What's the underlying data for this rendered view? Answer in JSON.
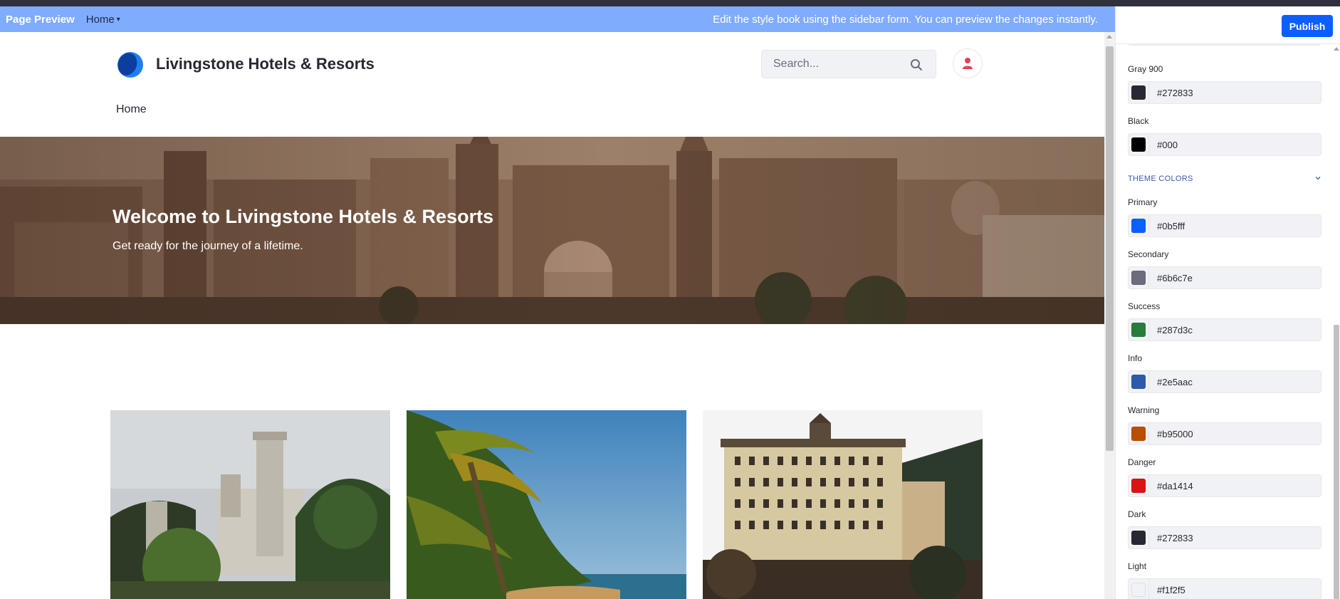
{
  "preview_bar": {
    "title": "Page Preview",
    "page_selector": "Home",
    "message": "Edit the style book using the sidebar form. You can preview the changes instantly."
  },
  "site": {
    "name": "Livingstone Hotels & Resorts",
    "search_placeholder": "Search...",
    "nav": [
      "Home"
    ]
  },
  "hero": {
    "title": "Welcome to Livingstone Hotels & Resorts",
    "subtitle": "Get ready for the journey of a lifetime."
  },
  "sidebar": {
    "publish_label": "Publish",
    "gray_fields": [
      {
        "label": "Gray 900",
        "value": "#272833",
        "color": "#272833"
      },
      {
        "label": "Black",
        "value": "#000",
        "color": "#000000"
      }
    ],
    "theme_section_title": "THEME COLORS",
    "theme_fields": [
      {
        "label": "Primary",
        "value": "#0b5fff",
        "color": "#0b5fff"
      },
      {
        "label": "Secondary",
        "value": "#6b6c7e",
        "color": "#6b6c7e"
      },
      {
        "label": "Success",
        "value": "#287d3c",
        "color": "#287d3c"
      },
      {
        "label": "Info",
        "value": "#2e5aac",
        "color": "#2e5aac"
      },
      {
        "label": "Warning",
        "value": "#b95000",
        "color": "#b95000"
      },
      {
        "label": "Danger",
        "value": "#da1414",
        "color": "#da1414"
      },
      {
        "label": "Dark",
        "value": "#272833",
        "color": "#272833"
      },
      {
        "label": "Light",
        "value": "#f1f2f5",
        "color": "#f1f2f5"
      }
    ]
  },
  "colors": {
    "preview_bar": "#80acff",
    "accent": "#0b5fff",
    "user_icon": "#e0434f"
  },
  "icons": {
    "search": "search-icon",
    "user": "user-icon",
    "chevron": "chevron-down-icon"
  }
}
